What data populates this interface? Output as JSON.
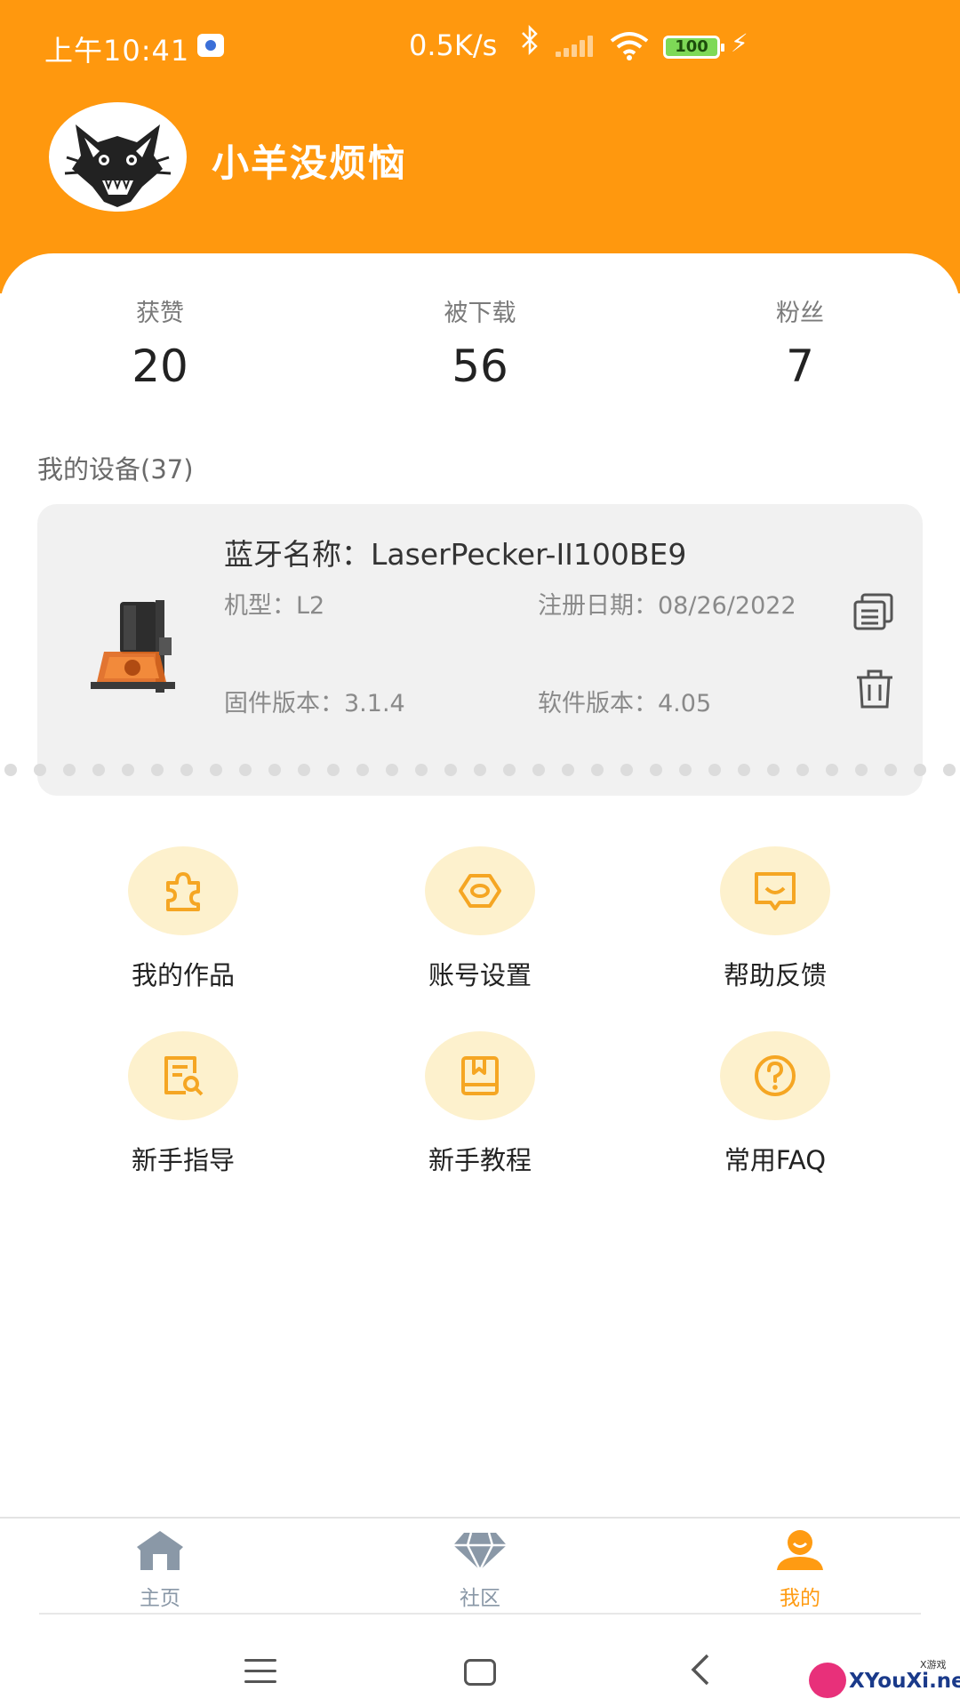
{
  "status_bar": {
    "time": "上午10:41",
    "net_speed": "0.5K/s",
    "bluetooth": "∗",
    "battery": "100",
    "charging": "⚡"
  },
  "profile": {
    "username": "小羊没烦恼"
  },
  "stats": [
    {
      "label": "获赞",
      "value": "20"
    },
    {
      "label": "被下载",
      "value": "56"
    },
    {
      "label": "粉丝",
      "value": "7"
    }
  ],
  "devices": {
    "section_title": "我的设备(37)",
    "card": {
      "bluetooth_name": "蓝牙名称：LaserPecker-II100BE9",
      "model": "机型：L2",
      "register_date": "注册日期：08/26/2022",
      "firmware": "固件版本：3.1.4",
      "software": "软件版本：4.05"
    }
  },
  "menu": [
    {
      "label": "我的作品",
      "icon": "puzzle-icon"
    },
    {
      "label": "账号设置",
      "icon": "settings-hex-icon"
    },
    {
      "label": "帮助反馈",
      "icon": "feedback-icon"
    },
    {
      "label": "新手指导",
      "icon": "guide-search-icon"
    },
    {
      "label": "新手教程",
      "icon": "book-icon"
    },
    {
      "label": "常用FAQ",
      "icon": "question-icon"
    }
  ],
  "tabs": [
    {
      "label": "主页",
      "icon": "home-icon",
      "active": false
    },
    {
      "label": "社区",
      "icon": "diamond-icon",
      "active": false
    },
    {
      "label": "我的",
      "icon": "user-icon",
      "active": true
    }
  ],
  "watermark": {
    "text": "XYouXi.net",
    "small": "X游戏"
  },
  "colors": {
    "brand_orange": "#ff980e",
    "icon_bg": "#fdf1cd",
    "icon_orange": "#f5a623",
    "tab_active": "#ff9b12",
    "tab_inactive": "#8a98a7"
  }
}
